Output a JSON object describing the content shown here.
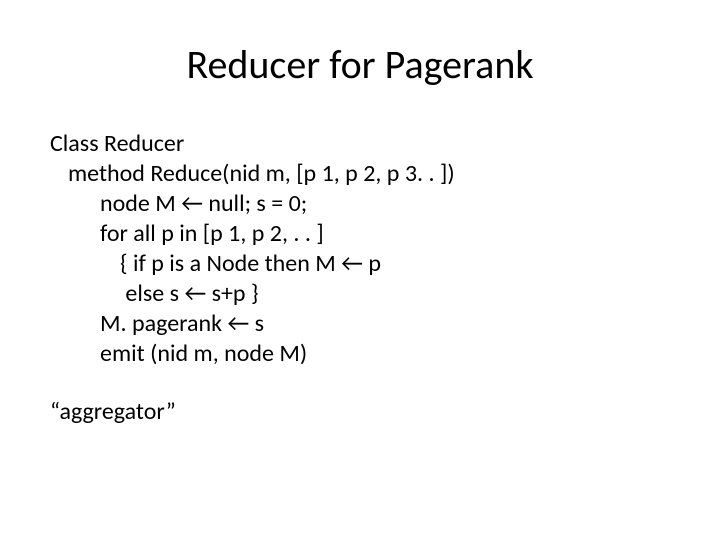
{
  "title": "Reducer for Pagerank",
  "body": {
    "l0": "Class Reducer",
    "l1": "method Reduce(nid m, [p 1, p 2, p 3. . ])",
    "l2": "node M ← null; s = 0;",
    "l3": "for all p in [p 1, p 2, . . ]",
    "l4": "{ if p is a Node then M ← p",
    "l5": " else s ← s+p }",
    "l6": "M. pagerank ← s",
    "l7": "emit (nid m, node M)",
    "note": "“aggregator”"
  }
}
